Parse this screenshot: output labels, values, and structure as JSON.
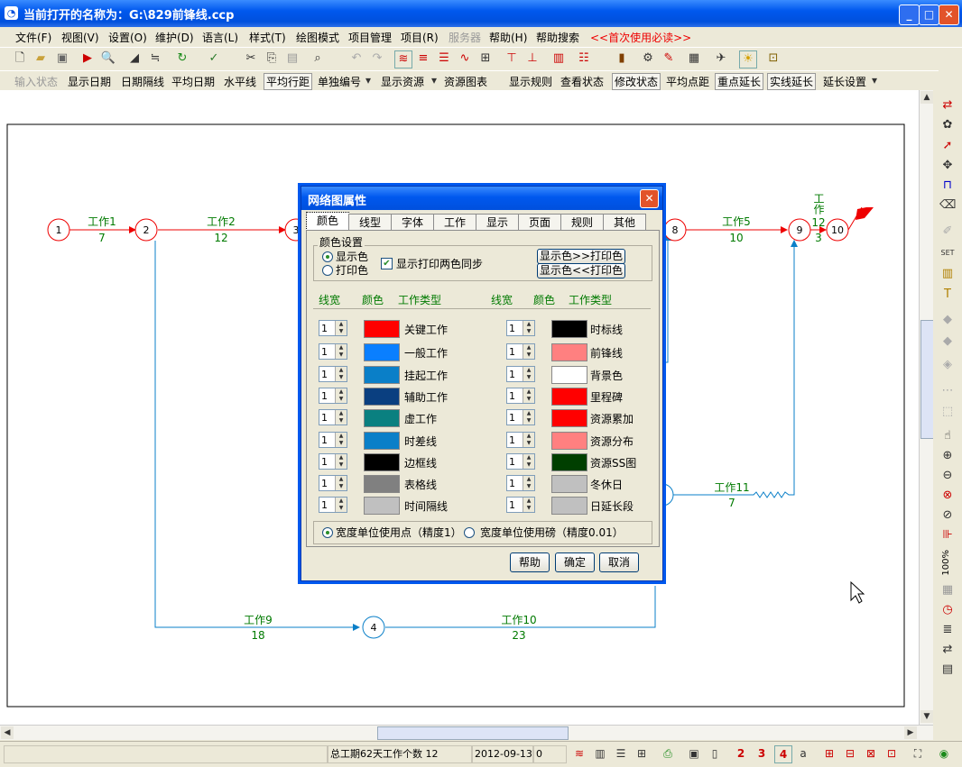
{
  "window": {
    "title": "当前打开的名称为：G:\\829前锋线.ccp"
  },
  "menu": [
    "文件(F)",
    "视图(V)",
    "设置(O)",
    "维护(D)",
    "语言(L)",
    "样式(T)",
    "绘图模式",
    "项目管理",
    "项目(R)",
    "服务器",
    "帮助(H)",
    "帮助搜索",
    "<<首次使用必读>>"
  ],
  "toolbar2": [
    "输入状态",
    "显示日期",
    "日期隔线",
    "平均日期",
    "水平线",
    "平均行距",
    "单独编号",
    "显示资源",
    "资源图表",
    "显示规则",
    "查看状态",
    "修改状态",
    "平均点距",
    "重点延长",
    "实线延长",
    "延长设置"
  ],
  "diagram": {
    "nodes": [
      "1",
      "2",
      "3",
      "4",
      "8",
      "9",
      "10"
    ],
    "works": [
      {
        "name": "工作1",
        "days": "7"
      },
      {
        "name": "工作2",
        "days": "12"
      },
      {
        "name": "工作5",
        "days": "10"
      },
      {
        "name": "工作",
        "days": "12"
      },
      {
        "name": "工作9",
        "days": "18"
      },
      {
        "name": "工作10",
        "days": "23"
      },
      {
        "name": "工作11",
        "days": "7"
      }
    ],
    "extra_num": "3"
  },
  "dialog": {
    "title": "网络图属性",
    "tabs": [
      "颜色",
      "线型",
      "字体",
      "工作",
      "显示",
      "页面",
      "规则",
      "其他"
    ],
    "group_label": "颜色设置",
    "radio_display": "显示色",
    "radio_print": "打印色",
    "sync_checkbox": "显示打印两色同步",
    "btn_to_print": "显示色>>打印色",
    "btn_to_display": "显示色<<打印色",
    "col_headers": {
      "width": "线宽",
      "color": "颜色",
      "type": "工作类型"
    },
    "left_rows": [
      {
        "width": "1",
        "color": "#FF0000",
        "label": "关键工作"
      },
      {
        "width": "1",
        "color": "#0A7FFF",
        "label": "一般工作"
      },
      {
        "width": "1",
        "color": "#0A7FC8",
        "label": "挂起工作"
      },
      {
        "width": "1",
        "color": "#0A3F80",
        "label": "辅助工作"
      },
      {
        "width": "1",
        "color": "#0A8080",
        "label": "虚工作"
      },
      {
        "width": "1",
        "color": "#0A7FC8",
        "label": "时差线"
      },
      {
        "width": "1",
        "color": "#000000",
        "label": "边框线"
      },
      {
        "width": "1",
        "color": "#808080",
        "label": "表格线"
      },
      {
        "width": "1",
        "color": "#C0C0C0",
        "label": "时间隔线"
      }
    ],
    "right_rows": [
      {
        "width": "1",
        "color": "#000000",
        "label": "时标线"
      },
      {
        "width": "1",
        "color": "#FF8080",
        "label": "前锋线"
      },
      {
        "width": "1",
        "color": "#FFFFFF",
        "label": "背景色"
      },
      {
        "width": "1",
        "color": "#FF0000",
        "label": "里程碑"
      },
      {
        "width": "1",
        "color": "#FF0000",
        "label": "资源累加"
      },
      {
        "width": "1",
        "color": "#FF8080",
        "label": "资源分布"
      },
      {
        "width": "1",
        "color": "#003F00",
        "label": "资源SS图"
      },
      {
        "width": "1",
        "color": "#C0C0C0",
        "label": "冬休日"
      },
      {
        "width": "1",
        "color": "#C0C0C0",
        "label": "日延长段"
      }
    ],
    "unit_points": "宽度单位使用点（精度1）",
    "unit_pounds": "宽度单位使用磅（精度0.01）",
    "help": "帮助",
    "ok": "确定",
    "cancel": "取消"
  },
  "status": {
    "summary": "总工期62天工作个数 12",
    "date": "2012-09-13",
    "count": "0"
  },
  "right_toolbar_zoom": "100%"
}
